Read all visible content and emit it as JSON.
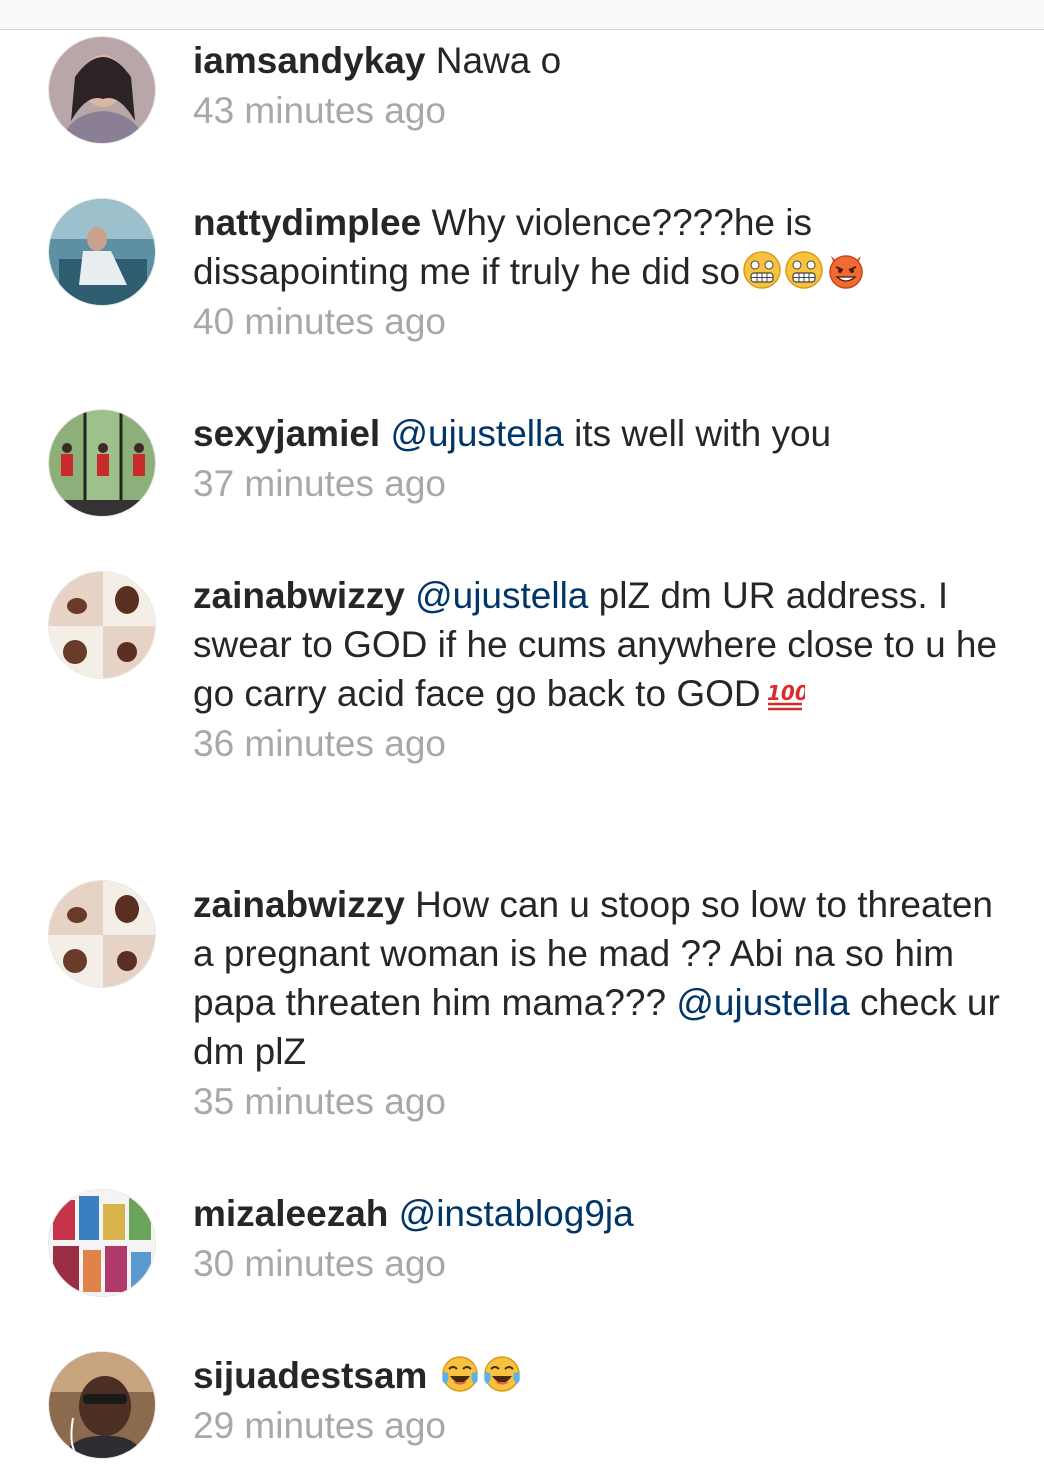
{
  "comments": [
    {
      "username": "iamsandykay",
      "segments": [
        {
          "text": "Nawa o"
        }
      ],
      "time": "43 minutes ago"
    },
    {
      "username": "nattydimplee",
      "segments": [
        {
          "text": "Why violence????he is dissapointing me if truly he did so"
        }
      ],
      "emojis": [
        "grimacing-face-emoji",
        "grimacing-face-emoji",
        "smiling-devil-emoji"
      ],
      "time": "40 minutes ago"
    },
    {
      "username": "sexyjamiel",
      "mention": "@ujustella",
      "segments": [
        {
          "text": "its well with you"
        }
      ],
      "time": "37 minutes ago"
    },
    {
      "username": "zainabwizzy",
      "mention": "@ujustella",
      "segments": [
        {
          "text": "plZ dm UR address. I swear to GOD if he cums anywhere close to u he go carry acid face go back to GOD"
        }
      ],
      "emojis": [
        "hundred-points-emoji"
      ],
      "time": "36 minutes ago"
    },
    {
      "username": "zainabwizzy",
      "segments": [
        {
          "text": "How can u stoop so low to threaten a pregnant woman is he mad ?? Abi na so him papa threaten him mama???"
        }
      ],
      "mention_after": "@ujustella",
      "segments_after": [
        {
          "text": "check ur dm plZ"
        }
      ],
      "time": "35 minutes ago"
    },
    {
      "username": "mizaleezah",
      "mention": "@instablog9ja",
      "segments": [],
      "time": "30 minutes ago"
    },
    {
      "username": "sijuadestsam",
      "segments": [],
      "emojis": [
        "tears-of-joy-emoji",
        "tears-of-joy-emoji"
      ],
      "time": "29 minutes ago"
    }
  ],
  "colors": {
    "text": "#262626",
    "mention": "#003569",
    "timestamp": "#a8a8a8"
  }
}
